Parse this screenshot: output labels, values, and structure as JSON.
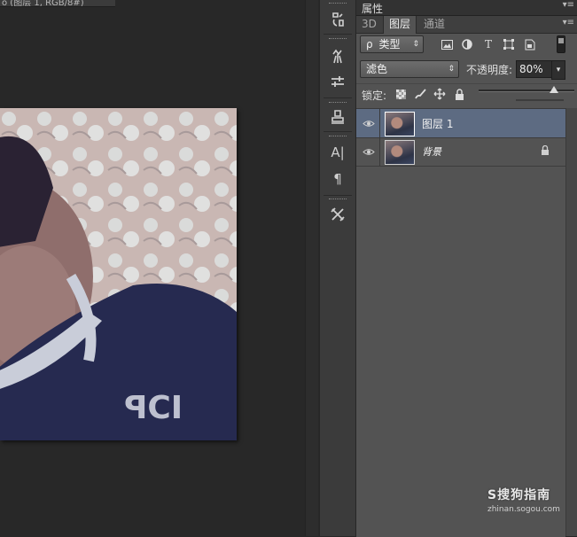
{
  "document": {
    "tab_label": "o (图层 1, RGB/8#)"
  },
  "tools_column": {
    "icons": [
      "history-brush-icon",
      "brush-presets-icon",
      "mixer-brush-icon",
      "clone-stamp-icon",
      "character-icon",
      "paragraph-icon",
      "tool-presets-icon"
    ]
  },
  "properties_panel": {
    "title": "属性",
    "menu_glyph": "▾≡"
  },
  "layers_panel": {
    "tabs": [
      {
        "label": "3D",
        "active": false
      },
      {
        "label": "图层",
        "active": true
      },
      {
        "label": "通道",
        "active": false
      }
    ],
    "menu_glyph": "▾≡",
    "filter": {
      "kind_label": "类型",
      "search_glyph": "ρ",
      "arrow": "⇕",
      "icons": [
        "pixel-layer-filter-icon",
        "adjustment-layer-filter-icon",
        "type-layer-filter-icon",
        "shape-layer-filter-icon",
        "smart-object-filter-icon"
      ]
    },
    "blend_mode": {
      "value": "滤色",
      "arrow": "⇕"
    },
    "opacity": {
      "label": "不透明度:",
      "value": "80%",
      "arrow": "▾"
    },
    "lock": {
      "label": "锁定:",
      "icons": [
        "lock-transparent-pixels-icon",
        "lock-image-pixels-icon",
        "lock-position-icon",
        "lock-all-icon"
      ]
    },
    "layers": [
      {
        "name": "图层 1",
        "selected": true,
        "visible": true,
        "locked": false
      },
      {
        "name": "背景",
        "selected": false,
        "visible": true,
        "locked": true
      }
    ]
  },
  "watermark": {
    "logo": "S搜狗指南",
    "url": "zhinan.sogou.com"
  }
}
